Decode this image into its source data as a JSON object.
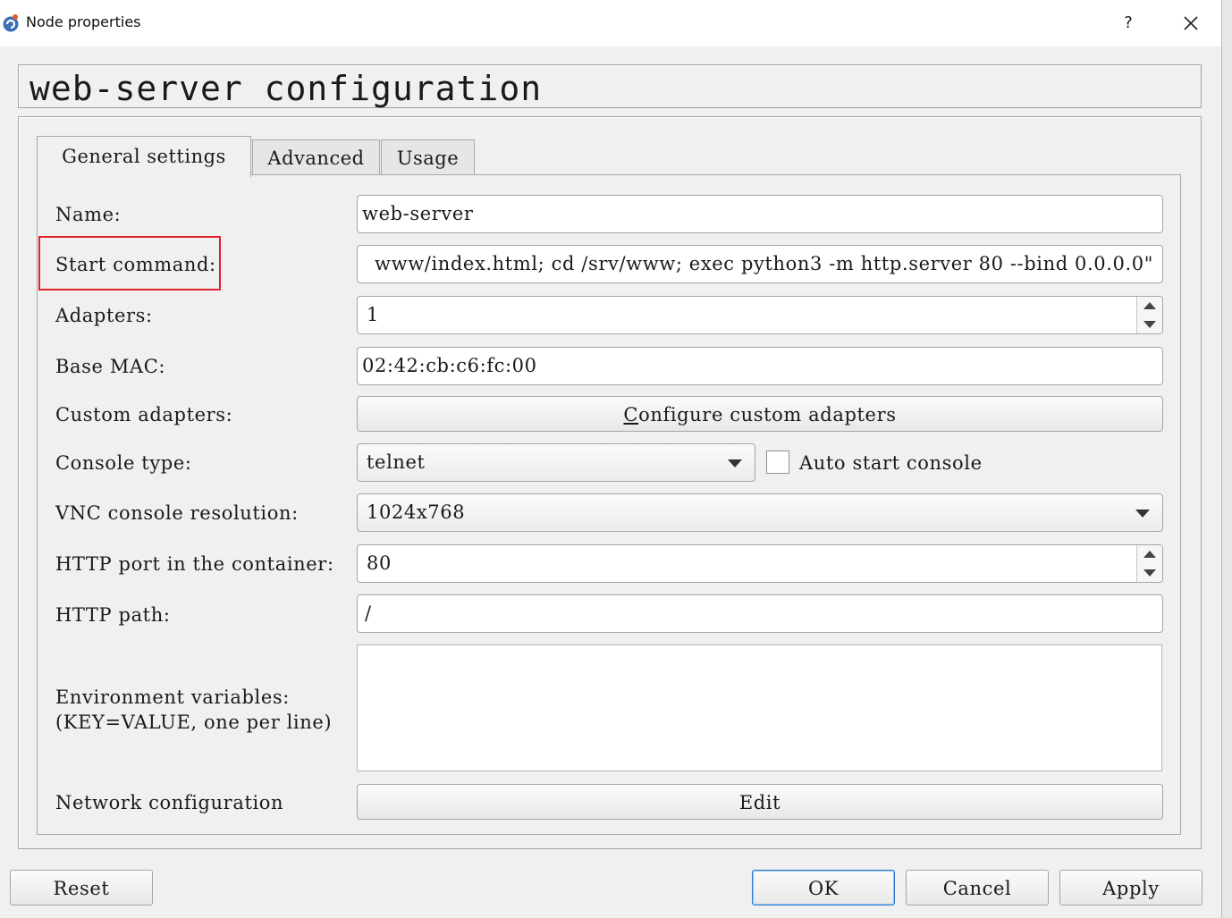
{
  "window": {
    "title": "Node properties",
    "help_label": "?",
    "icon": "gns3-app-icon"
  },
  "header": {
    "title": "web-server configuration"
  },
  "tabs": [
    {
      "label": "General settings",
      "active": true
    },
    {
      "label": "Advanced",
      "active": false
    },
    {
      "label": "Usage",
      "active": false
    }
  ],
  "form": {
    "name": {
      "label": "Name:",
      "value": "web-server"
    },
    "start_command": {
      "label": "Start command:",
      "value": "www/index.html; cd /srv/www; exec python3 -m http.server 80 --bind 0.0.0.0\""
    },
    "adapters": {
      "label": "Adapters:",
      "value": "1"
    },
    "base_mac": {
      "label": "Base MAC:",
      "value": "02:42:cb:c6:fc:00"
    },
    "custom_adapters": {
      "label": "Custom adapters:",
      "button_label_prefix": "C",
      "button_label_rest": "onfigure custom adapters"
    },
    "console_type": {
      "label": "Console type:",
      "value": "telnet",
      "auto_start_label": "Auto start console",
      "auto_start_checked": false
    },
    "vnc_resolution": {
      "label": "VNC console resolution:",
      "value": "1024x768"
    },
    "http_port": {
      "label": "HTTP port in the container:",
      "value": "80"
    },
    "http_path": {
      "label": "HTTP path:",
      "value": "/"
    },
    "env_vars": {
      "label_line1": "Environment variables:",
      "label_line2": "(KEY=VALUE, one per line)",
      "value": ""
    },
    "network_config": {
      "label": "Network configuration",
      "button_label": "Edit"
    }
  },
  "buttons": {
    "reset": "Reset",
    "ok": "OK",
    "cancel": "Cancel",
    "apply": "Apply"
  },
  "colors": {
    "highlight": "#e0222c",
    "ok_focus": "#2a7bd4"
  }
}
